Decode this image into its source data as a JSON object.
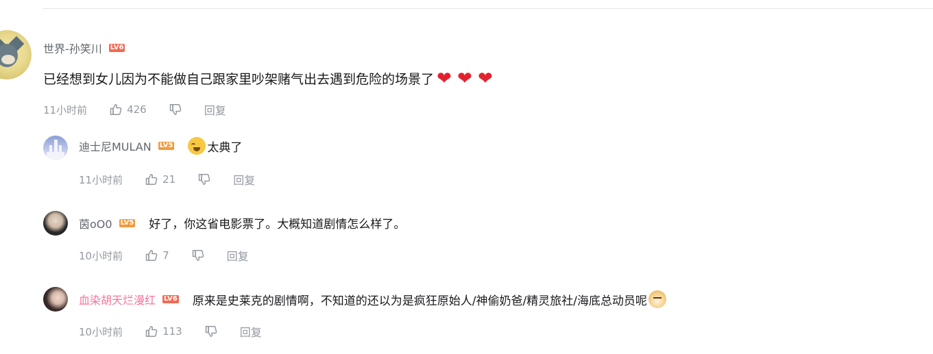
{
  "colors": {
    "level6_badge": "#ef6b55",
    "level5_badge": "#f29b3a",
    "heart": "#e3222d",
    "vip_name": "#fb7299"
  },
  "main_comment": {
    "username": "世界-孙笑川",
    "level_badge": "LV6",
    "text": "已经想到女儿因为不能做自己跟家里吵架赌气出去遇到危险的场景了",
    "trailing_emoji": [
      "heart",
      "heart",
      "heart"
    ],
    "time": "11小时前",
    "likes": "426",
    "reply_label": "回复"
  },
  "replies": [
    {
      "username": "迪士尼MULAN",
      "level_badge": "LV5",
      "leading_emoji": "laughing-crying-face",
      "text": "太典了",
      "time": "11小时前",
      "likes": "21",
      "reply_label": "回复"
    },
    {
      "username": "茵oO0",
      "level_badge": "LV5",
      "text": "好了，你这省电影票了。大概知道剧情怎么样了。",
      "time": "10小时前",
      "likes": "7",
      "reply_label": "回复"
    },
    {
      "username": "血染胡天烂漫红",
      "level_badge": "LV6",
      "text": "原来是史莱克的剧情啊，不知道的还以为是疯狂原始人/神偷奶爸/精灵旅社/海底总动员呢",
      "trailing_emoji": "doge",
      "time": "10小时前",
      "likes": "113",
      "reply_label": "回复"
    }
  ]
}
